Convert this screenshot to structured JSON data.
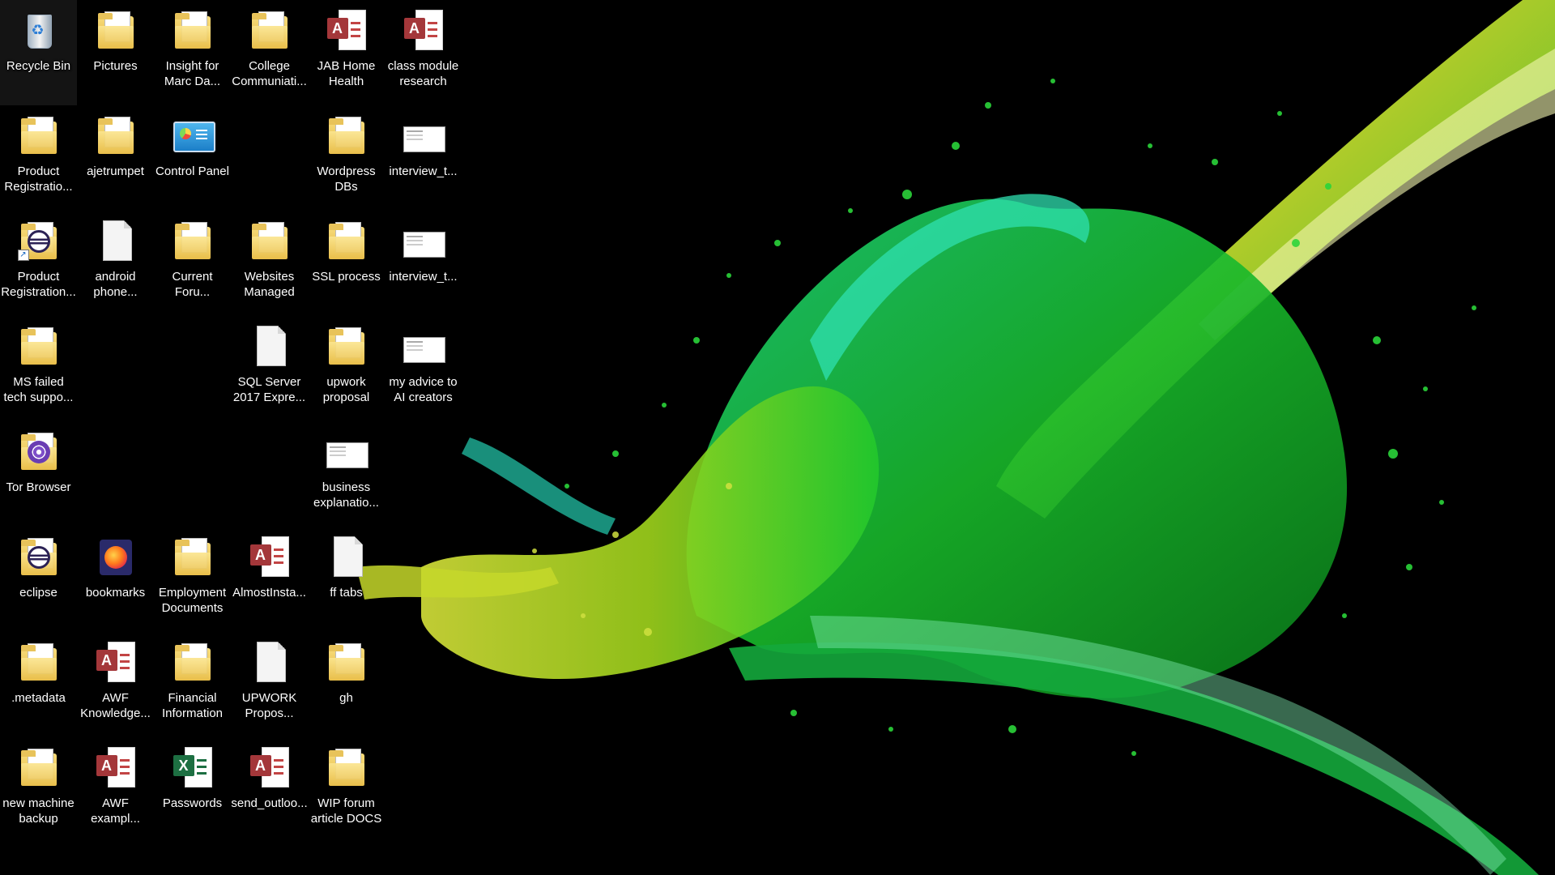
{
  "desktop": {
    "icons": [
      {
        "label": "Recycle Bin",
        "type": "recycle-bin"
      },
      {
        "label": "Pictures",
        "type": "folder"
      },
      {
        "label": "Insight for\nMarc Da...",
        "type": "folder"
      },
      {
        "label": "College\nCommuniati...",
        "type": "folder-word"
      },
      {
        "label": "JAB Home\nHealth",
        "type": "access"
      },
      {
        "label": "class module\nresearch",
        "type": "access"
      },
      {
        "label": "Product\nRegistratio...",
        "type": "folder"
      },
      {
        "label": "ajetrumpet",
        "type": "folder"
      },
      {
        "label": "Control Panel",
        "type": "control-panel"
      },
      {
        "label": "Wordpress\nDBs",
        "type": "folder"
      },
      {
        "label": "interview_t...",
        "type": "image"
      },
      {
        "label": "Product\nRegistration...",
        "type": "folder-shortcut"
      },
      {
        "label": "android\nphone...",
        "type": "document"
      },
      {
        "label": "Current\nForu...",
        "type": "folder"
      },
      {
        "label": "Websites\nManaged",
        "type": "folder"
      },
      {
        "label": "SSL process",
        "type": "folder"
      },
      {
        "label": "interview_t...",
        "type": "image"
      },
      {
        "label": "MS failed\ntech suppo...",
        "type": "folder"
      },
      {
        "label": "SQL Server\n2017 Expre...",
        "type": "document"
      },
      {
        "label": "upwork\nproposal",
        "type": "folder"
      },
      {
        "label": "my advice to\nAI creators",
        "type": "image"
      },
      {
        "label": "Tor Browser",
        "type": "tor"
      },
      {
        "label": "business\nexplanatio...",
        "type": "image"
      },
      {
        "label": "eclipse",
        "type": "eclipse"
      },
      {
        "label": "bookmarks",
        "type": "firefox"
      },
      {
        "label": "Employment\nDocuments",
        "type": "folder"
      },
      {
        "label": "AlmostInsta...",
        "type": "access"
      },
      {
        "label": "ff tabs",
        "type": "document"
      },
      {
        "label": ".metadata",
        "type": "folder"
      },
      {
        "label": "AWF\nKnowledge...",
        "type": "access"
      },
      {
        "label": "Financial\nInformation",
        "type": "folder-excel"
      },
      {
        "label": "UPWORK\nPropos...",
        "type": "document"
      },
      {
        "label": "gh",
        "type": "folder"
      },
      {
        "label": "new machine\nbackup",
        "type": "folder"
      },
      {
        "label": "AWF\nexampl...",
        "type": "access"
      },
      {
        "label": "Passwords",
        "type": "excel"
      },
      {
        "label": "send_outloo...",
        "type": "access"
      },
      {
        "label": "WIP forum\narticle DOCS",
        "type": "folder"
      }
    ]
  },
  "colors": {
    "background": "#000000",
    "splash_green": "#1fd12a",
    "splash_yellow": "#c8d82a",
    "splash_teal": "#1fb39a"
  }
}
